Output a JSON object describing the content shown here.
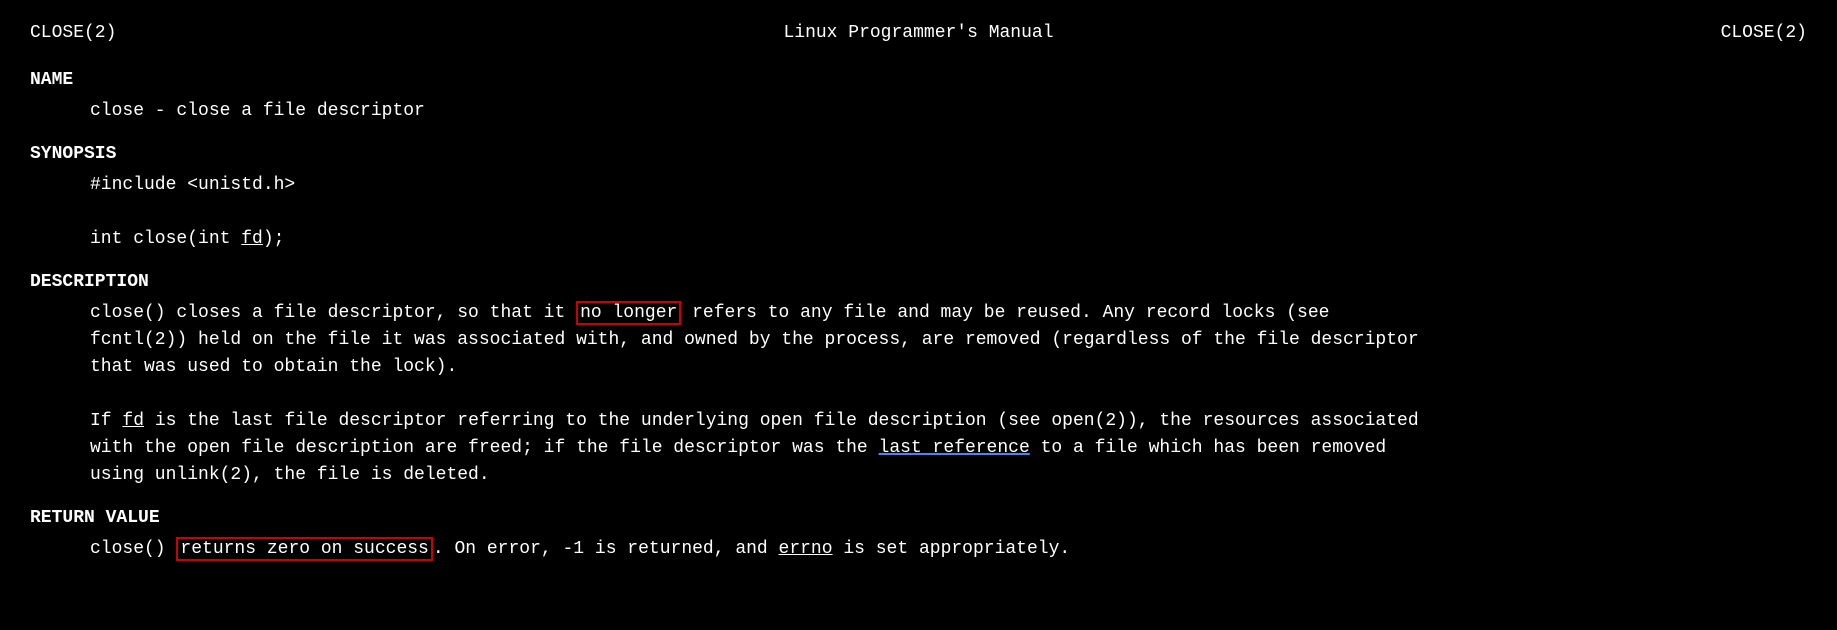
{
  "header": {
    "left": "CLOSE(2)",
    "center": "Linux Programmer's Manual",
    "right": "CLOSE(2)"
  },
  "sections": {
    "name": {
      "title": "NAME",
      "content": "close - close a file descriptor"
    },
    "synopsis": {
      "title": "SYNOPSIS",
      "include": "#include <unistd.h>",
      "signature": "int close(int fd);"
    },
    "description": {
      "title": "DESCRIPTION",
      "para1_before": "close()  closes  a  file  descriptor,  so  that  it ",
      "para1_highlight": "no longer",
      "para1_after": " refers to any file and may be reused.  Any record locks (see",
      "para1_line2": "fcntl(2)) held on the file it was associated with, and owned by the process, are removed (regardless of the file descriptor",
      "para1_line3": "that was used to obtain the lock).",
      "para2_line1_before": "If ",
      "para2_fd": "fd",
      "para2_line1_mid": " is the last file descriptor referring to the underlying open file description (see open(2)), the resources associated",
      "para2_line2_before": "with the open file description are freed; if the file descriptor was the ",
      "para2_last_ref": "last reference",
      "para2_line2_after": " to a file which  has  been  removed",
      "para2_line3": "using unlink(2), the file is deleted."
    },
    "return_value": {
      "title": "RETURN VALUE",
      "content_before": "close() ",
      "content_highlight": "returns zero on success",
      "content_after": ".  On error, -1 is returned, and ",
      "content_errno": "errno",
      "content_end": " is set appropriately."
    }
  }
}
